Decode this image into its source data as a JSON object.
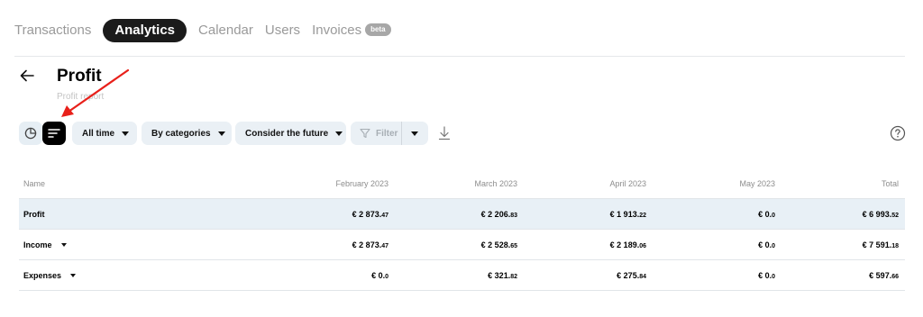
{
  "tabs": [
    {
      "label": "Transactions",
      "active": false
    },
    {
      "label": "Analytics",
      "active": true
    },
    {
      "label": "Calendar",
      "active": false
    },
    {
      "label": "Users",
      "active": false
    },
    {
      "label": "Invoices",
      "active": false,
      "badge": "beta"
    }
  ],
  "header": {
    "title": "Profit",
    "subtitle": "Profit report"
  },
  "toolbar": {
    "view_icons": [
      "pie-chart-icon",
      "table-lines-icon"
    ],
    "period": "All time",
    "grouping": "By categories",
    "future": "Consider the future",
    "filter": "Filter"
  },
  "table": {
    "columns": [
      "Name",
      "February 2023",
      "March 2023",
      "April 2023",
      "May 2023",
      "Total"
    ],
    "rows": [
      {
        "name": "Profit",
        "expandable": false,
        "highlighted": true,
        "values": [
          {
            "main": "€ 2 873.",
            "cents": "47"
          },
          {
            "main": "€ 2 206.",
            "cents": "83"
          },
          {
            "main": "€ 1 913.",
            "cents": "22"
          },
          {
            "main": "€ 0.",
            "cents": "0"
          },
          {
            "main": "€ 6 993.",
            "cents": "52"
          }
        ]
      },
      {
        "name": "Income",
        "expandable": true,
        "highlighted": false,
        "values": [
          {
            "main": "€ 2 873.",
            "cents": "47"
          },
          {
            "main": "€ 2 528.",
            "cents": "65"
          },
          {
            "main": "€ 2 189.",
            "cents": "06"
          },
          {
            "main": "€ 0.",
            "cents": "0"
          },
          {
            "main": "€ 7 591.",
            "cents": "18"
          }
        ]
      },
      {
        "name": "Expenses",
        "expandable": true,
        "highlighted": false,
        "values": [
          {
            "main": "€ 0.",
            "cents": "0"
          },
          {
            "main": "€ 321.",
            "cents": "82"
          },
          {
            "main": "€ 275.",
            "cents": "84"
          },
          {
            "main": "€ 0.",
            "cents": "0"
          },
          {
            "main": "€ 597.",
            "cents": "66"
          }
        ]
      }
    ]
  },
  "colors": {
    "accent_dark": "#1b1b1b",
    "highlight_row": "#e8f0f6",
    "chip_bg": "#eaf0f5",
    "annotation_arrow": "#e8201a"
  }
}
